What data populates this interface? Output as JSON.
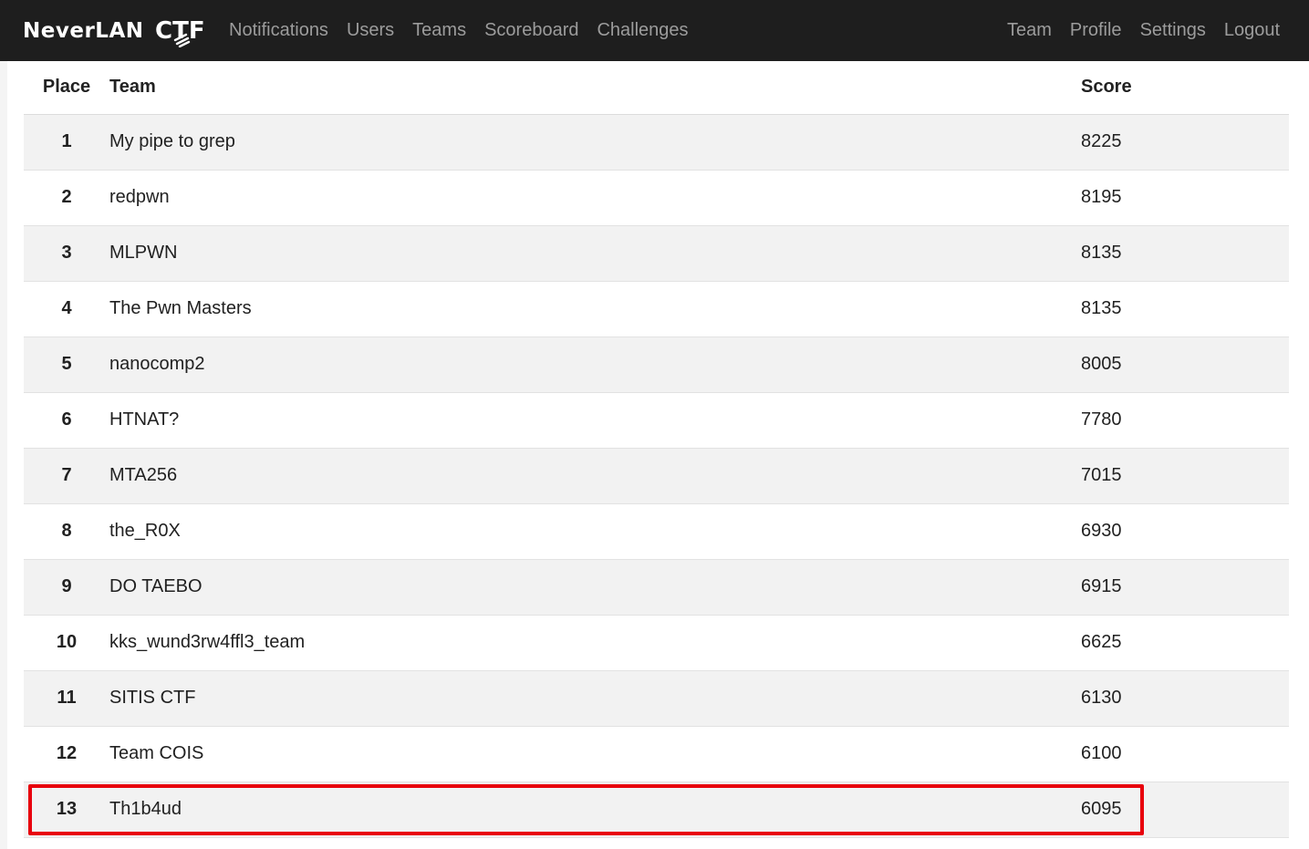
{
  "brand": {
    "name": "NeverLAN",
    "logo_text": "CTF"
  },
  "nav_left": [
    {
      "label": "Notifications"
    },
    {
      "label": "Users"
    },
    {
      "label": "Teams"
    },
    {
      "label": "Scoreboard"
    },
    {
      "label": "Challenges"
    }
  ],
  "nav_right": [
    {
      "label": "Team"
    },
    {
      "label": "Profile"
    },
    {
      "label": "Settings"
    },
    {
      "label": "Logout"
    }
  ],
  "scoreboard": {
    "headers": {
      "place": "Place",
      "team": "Team",
      "score": "Score"
    },
    "rows": [
      {
        "place": "1",
        "team": "My pipe to grep",
        "score": "8225"
      },
      {
        "place": "2",
        "team": "redpwn",
        "score": "8195"
      },
      {
        "place": "3",
        "team": "MLPWN",
        "score": "8135"
      },
      {
        "place": "4",
        "team": "The Pwn Masters",
        "score": "8135"
      },
      {
        "place": "5",
        "team": "nanocomp2",
        "score": "8005"
      },
      {
        "place": "6",
        "team": "HTNAT?",
        "score": "7780"
      },
      {
        "place": "7",
        "team": "MTA256",
        "score": "7015"
      },
      {
        "place": "8",
        "team": "the_R0X",
        "score": "6930"
      },
      {
        "place": "9",
        "team": "DO TAEBO",
        "score": "6915"
      },
      {
        "place": "10",
        "team": "kks_wund3rw4ffl3_team",
        "score": "6625"
      },
      {
        "place": "11",
        "team": "SITIS CTF",
        "score": "6130"
      },
      {
        "place": "12",
        "team": "Team COIS",
        "score": "6100"
      },
      {
        "place": "13",
        "team": "Th1b4ud",
        "score": "6095"
      }
    ],
    "highlighted_place": "13"
  },
  "colors": {
    "navbar_bg": "#1e1e1e",
    "nav_link": "#9c9c9c",
    "highlight": "#e8000c",
    "row_stripe": "#f2f2f2"
  }
}
